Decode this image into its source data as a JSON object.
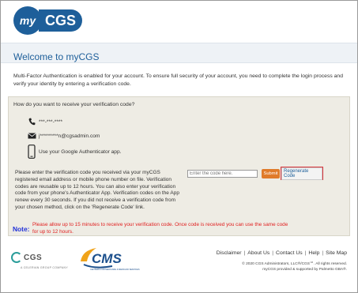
{
  "header": {
    "logo_badge": "my",
    "logo_text": "CGS"
  },
  "welcome": "Welcome to myCGS",
  "intro": "Multi-Factor Authentication is enabled for your account. To ensure full security of your account, you need to complete the login process and verify your identity by entering a verification code.",
  "panel": {
    "question": "How do you want to receive your verification code?",
    "options": [
      {
        "icon": "phone-icon",
        "label": "***-***-****"
      },
      {
        "icon": "email-icon",
        "label": "j*********n@cgsadmin.com"
      },
      {
        "icon": "mobile-device-icon",
        "label": "Use your Google Authenticator app."
      }
    ],
    "instructions": "Please enter the verification code you received via your myCGS registered email address or mobile phone number on file. Verification codes are reusable up to 12 hours. You can also enter your verification code from your phone's Authenticator App. Verification codes on the App renew every 30 seconds. If you did not receive a verification code from your chosen method, click on the 'Regenerate Code' link.",
    "code_placeholder": "Enter the code here.",
    "submit_label": "Submit",
    "regenerate_label": "Regenerate Code",
    "note_label": "Note:",
    "note_text": "Please allow up to 15 minutes to receive your verification code. Once code is received you can use the same code for up to 12 hours."
  },
  "footer": {
    "cgs_logo_text": "CGS",
    "cgs_tagline": "A CELERIAN GROUP COMPANY",
    "cms_logo_text": "CMS",
    "cms_tagline": "CENTERS FOR MEDICARE & MEDICAID SERVICES",
    "links": [
      "Disclaimer",
      "About Us",
      "Contact Us",
      "Help",
      "Site Map"
    ],
    "copyright_1": "© 2020 CGS Administrators, LLC®/CGS℠. All rights reserved.",
    "copyright_2": "myCGS provided & supported by Palmetto GBA®."
  },
  "colors": {
    "brand_blue": "#1e5f9a",
    "submit_orange": "#e07b2a",
    "highlight_red": "#d9343a",
    "note_blue": "#2232d8",
    "note_red": "#e02020"
  }
}
